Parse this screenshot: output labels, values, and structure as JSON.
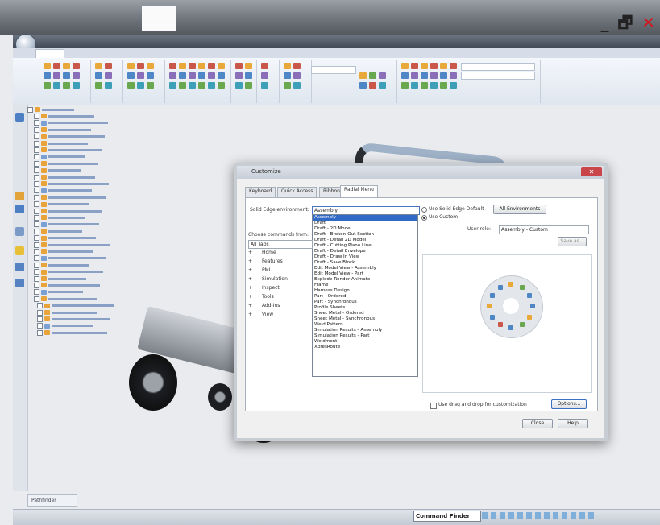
{
  "window": {
    "minimize": "_",
    "restore": "🗗",
    "close": "✕"
  },
  "app": {
    "title": "",
    "document": ""
  },
  "status": {
    "pathfinder_tab": "Pathfinder",
    "command_finder": "Command Finder"
  },
  "dialog": {
    "title": "Customize",
    "close": "✕",
    "tabs": [
      "Keyboard",
      "Quick Access",
      "Ribbon",
      "Radial Menu"
    ],
    "active_tab": 3,
    "env_label": "Solid Edge environment:",
    "env_value": "Assembly",
    "env_options": [
      "Assembly",
      "Draft",
      "Draft - 2D Model",
      "Draft - Broken-Out Section",
      "Draft - Detail 2D Model",
      "Draft - Cutting Plane Line",
      "Draft - Detail Envelope",
      "Draft - Draw In View",
      "Draft - Save Block",
      "Edit Model View - Assembly",
      "Edit Model View - Part",
      "Explode-Render-Animate",
      "Frame",
      "Harness Design",
      "Part - Ordered",
      "Part - Synchronous",
      "Profile Sheets",
      "Sheet Metal - Ordered",
      "Sheet Metal - Synchronous",
      "Weld Pattern",
      "Simulation Results - Assembly",
      "Simulation Results - Part",
      "Weldment",
      "XpresRoute"
    ],
    "cmd_label": "Choose commands from:",
    "cmd_value": "All Tabs",
    "cmd_tree": [
      "Home",
      "Features",
      "PMI",
      "Simulation",
      "Inspect",
      "Tools",
      "Add-Ins",
      "View"
    ],
    "radio_default": "Use Solid Edge Default",
    "radio_custom": "Use Custom",
    "all_env_button": "All Environments",
    "user_role_label": "User role:",
    "user_role_value": "Assembly - Custom",
    "save_as": "Save as...",
    "dragdrop_label": "Use drag and drop for customization",
    "options_button": "Options...",
    "close_button": "Close",
    "help_button": "Help"
  }
}
